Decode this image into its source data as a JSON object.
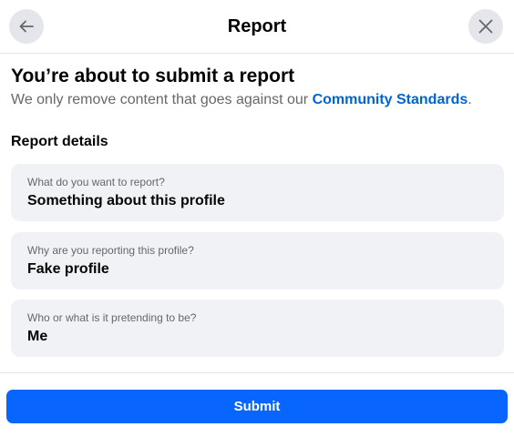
{
  "header": {
    "title": "Report",
    "back_icon": "arrow-left-icon",
    "close_icon": "close-x-icon"
  },
  "intro": {
    "title": "You’re about to submit a report",
    "subtitle_prefix": "We only remove content that goes against our ",
    "subtitle_link": "Community Standards",
    "subtitle_suffix": "."
  },
  "details": {
    "section_title": "Report details",
    "fields": [
      {
        "label": "What do you want to report?",
        "value": "Something about this profile"
      },
      {
        "label": "Why are you reporting this profile?",
        "value": "Fake profile"
      },
      {
        "label": "Who or what is it pretending to be?",
        "value": "Me"
      }
    ]
  },
  "footer": {
    "submit_label": "Submit"
  },
  "colors": {
    "accent": "#0866ff",
    "link": "#0064d1",
    "field_bg": "#f0f2f5",
    "icon_circle_bg": "#e4e6eb"
  }
}
